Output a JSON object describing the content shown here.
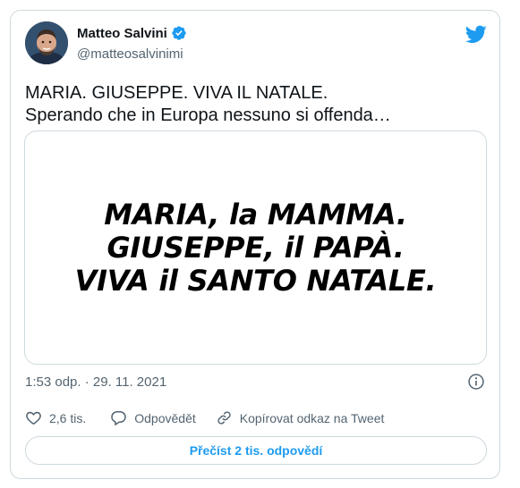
{
  "header": {
    "display_name": "Matteo Salvini",
    "handle": "@matteosalvinimi",
    "verified_icon": "verified-badge-icon",
    "brand_icon": "twitter-bird-icon",
    "brand_color": "#1d9bf0"
  },
  "tweet": {
    "line1": "MARIA. GIUSEPPE. VIVA IL NATALE.",
    "line2": "Sperando che in Europa nessuno si offenda…"
  },
  "media": {
    "line1": "MARIA, la MAMMA.",
    "line2": "GIUSEPPE, il PAPÀ.",
    "line3": "VIVA il SANTO NATALE."
  },
  "meta": {
    "timestamp": "1:53 odp. · 29. 11. 2021",
    "info_icon": "info-icon"
  },
  "actions": {
    "like_count": "2,6 tis.",
    "reply_label": "Odpovědět",
    "copy_link_label": "Kopírovat odkaz na Tweet"
  },
  "footer": {
    "read_replies_label": "Přečíst 2 tis. odpovědí"
  }
}
